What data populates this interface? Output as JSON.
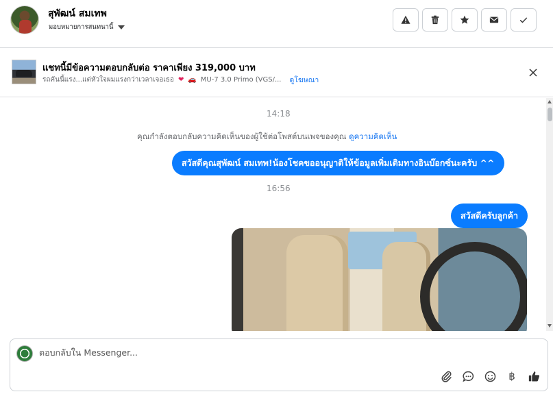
{
  "header": {
    "contact_name": "สุพัฒน์ สมเทพ",
    "assign_label": "มอบหมายการสนทนานี้",
    "buttons": [
      {
        "name": "spam-button",
        "icon": "warning-icon"
      },
      {
        "name": "delete-button",
        "icon": "trash-icon"
      },
      {
        "name": "star-button",
        "icon": "star-icon"
      },
      {
        "name": "mark-unread-button",
        "icon": "envelope-icon"
      },
      {
        "name": "mark-done-button",
        "icon": "check-icon"
      }
    ]
  },
  "ad_banner": {
    "title": "แชทนี้มีข้อความตอบกลับต่อ ราคาเพียง 319,000 บาท",
    "subtitle": "รถคันนี้แรง...แต่หัวใจผมแรงกว่าเวลาเจอเธอ",
    "model": "MU-7 3.0 Primo (VGS/...",
    "link": "ดูโฆษณา"
  },
  "chat": {
    "timestamp1": "14:18",
    "notice_text": "คุณกำลังตอบกลับความคิดเห็นของผู้ใช้ต่อโพสต์บนเพจของคุณ",
    "notice_link": "ดูความคิดเห็น",
    "msg1": "สวัสดีคุณสุพัฒน์ สมเทพ!น้องโชคขออนุญาติให้ข้อมูลเพิ่มเติมทางอินบ๊อกซ์นะครับ ^^",
    "timestamp2": "16:56",
    "msg2": "สวัสดีครับลูกค้า"
  },
  "composer": {
    "placeholder": "ตอบกลับใน Messenger...",
    "baht_symbol": "฿"
  },
  "colors": {
    "bubble": "#0a7cff",
    "link": "#1877f2"
  }
}
